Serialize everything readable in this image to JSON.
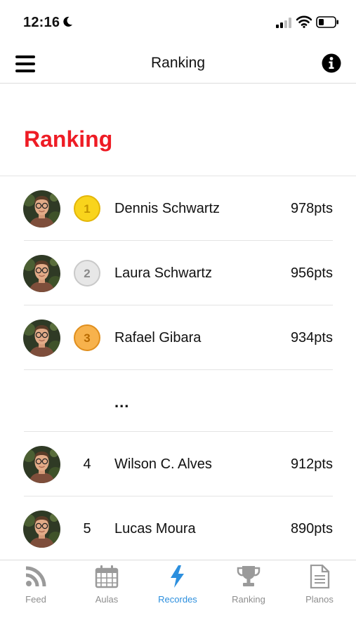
{
  "status_bar": {
    "time": "12:16"
  },
  "nav": {
    "title": "Ranking"
  },
  "page": {
    "heading": "Ranking"
  },
  "ranking": [
    {
      "position": "1",
      "name": "Dennis Schwartz",
      "points": "978pts",
      "medal": "gold"
    },
    {
      "position": "2",
      "name": "Laura Schwartz",
      "points": "956pts",
      "medal": "silver"
    },
    {
      "position": "3",
      "name": "Rafael Gibara",
      "points": "934pts",
      "medal": "bronze"
    },
    {
      "position": "4",
      "name": "Wilson C. Alves",
      "points": "912pts"
    },
    {
      "position": "5",
      "name": "Lucas Moura",
      "points": "890pts"
    }
  ],
  "ellipsis": "...",
  "tabs": [
    {
      "label": "Feed",
      "icon": "rss-icon"
    },
    {
      "label": "Aulas",
      "icon": "calendar-icon"
    },
    {
      "label": "Recordes",
      "icon": "lightning-icon",
      "active": true
    },
    {
      "label": "Ranking",
      "icon": "trophy-icon"
    },
    {
      "label": "Planos",
      "icon": "document-icon"
    }
  ],
  "colors": {
    "accent": "#2c8fde",
    "heading": "#ee1c25",
    "gold": "#f9d41c",
    "silver": "#e7e7e7",
    "bronze": "#f7b24c"
  }
}
